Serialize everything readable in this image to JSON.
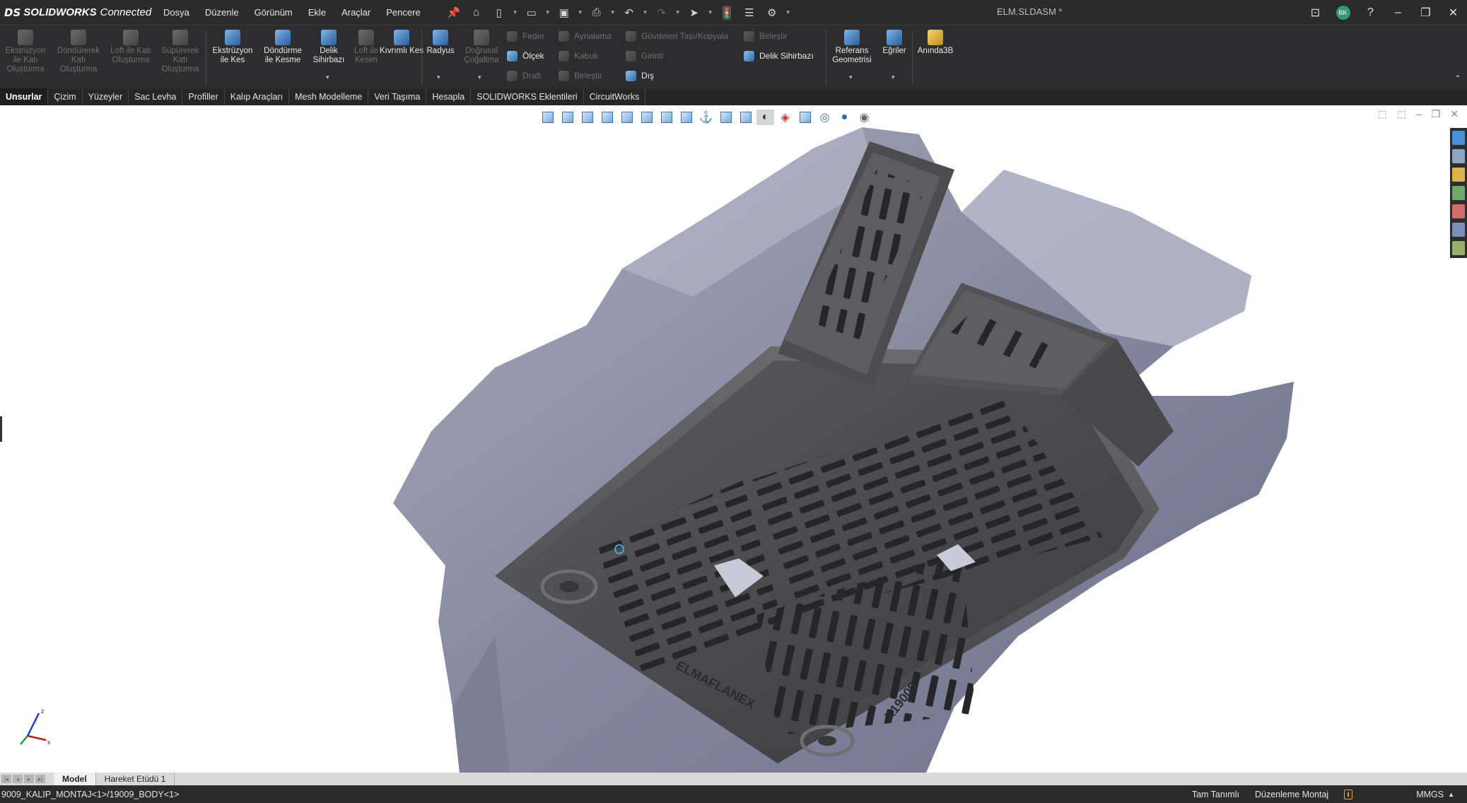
{
  "app": {
    "brand_ds": "DS",
    "brand_name": "SOLIDWORKS",
    "brand_suffix": "Connected",
    "document_title": "ELM.SLDASM *",
    "user_initials": "BK"
  },
  "menu": [
    "Dosya",
    "Düzenle",
    "Görünüm",
    "Ekle",
    "Araçlar",
    "Pencere"
  ],
  "quick_access": [
    "pin-icon",
    "home-icon",
    "new-file-icon",
    "open-file-icon",
    "save-icon",
    "print-icon",
    "undo-icon",
    "redo-icon",
    "select-icon",
    "traffic-light-icon",
    "file-properties-icon",
    "options-gear-icon"
  ],
  "ribbon": {
    "large_buttons": [
      {
        "label": "Ekstrüzyon ile Katı Oluşturma",
        "enabled": false
      },
      {
        "label": "Döndürerek Katı Oluşturma",
        "enabled": false
      },
      {
        "label": "Loft ile Katı Oluşturma",
        "enabled": false
      },
      {
        "label": "Süpürerek Katı Oluşturma",
        "enabled": false
      },
      {
        "label": "Ekstrüzyon ile Kes",
        "enabled": true
      },
      {
        "label": "Döndürme ile Kesme",
        "enabled": true
      },
      {
        "label": "Delik Sihirbazı",
        "enabled": true
      },
      {
        "label": "Loft ile Kesim",
        "enabled": false
      },
      {
        "label": "Kıvrımlı Kes",
        "enabled": true
      },
      {
        "label": "Radyus",
        "enabled": true
      },
      {
        "label": "Doğrusal Çoğaltma",
        "enabled": false
      },
      {
        "label": "Referans Geometrisi",
        "enabled": true
      },
      {
        "label": "Eğriler",
        "enabled": true
      },
      {
        "label": "Anında3B",
        "enabled": true
      }
    ],
    "small_buttons": [
      {
        "label": "Feder",
        "enabled": false
      },
      {
        "label": "Ölçek",
        "enabled": true
      },
      {
        "label": "Draft",
        "enabled": false
      },
      {
        "label": "Aynalama",
        "enabled": false
      },
      {
        "label": "Kabuk",
        "enabled": false
      },
      {
        "label": "Birleştir",
        "enabled": false
      },
      {
        "label": "Gövdeleri Taşı/Kopyala",
        "enabled": false
      },
      {
        "label": "Girinti",
        "enabled": false
      },
      {
        "label": "Dış",
        "enabled": true
      },
      {
        "label": "Birleştir",
        "enabled": false
      },
      {
        "label": "Delik Sihirbazı",
        "enabled": true
      }
    ]
  },
  "tabs": [
    "Unsurlar",
    "Çizim",
    "Yüzeyler",
    "Sac Levha",
    "Profiller",
    "Kalıp Araçları",
    "Mesh Modelleme",
    "Veri Taşıma",
    "Hesapla",
    "SOLIDWORKS Eklentileri",
    "CircuitWorks"
  ],
  "active_tab": "Unsurlar",
  "viewport": {
    "mat_logo_text": "ELMAFLANEX",
    "mat_code_text": "X19009",
    "triad_labels": [
      "z",
      "x",
      "y"
    ]
  },
  "bottom_tabs": [
    "Model",
    "Hareket Etüdü 1"
  ],
  "active_bottom_tab": "Model",
  "status": {
    "path": "9009_KALIP_MONTAJ<1>/19009_BODY<1>",
    "definition": "Tam Tanımlı",
    "mode": "Düzenleme Montaj",
    "units": "MMGS"
  },
  "colors": {
    "titlebar": "#2b2b2b",
    "ribbon": "#2d2d30",
    "scan_mesh": "#8e92a8",
    "mat_surface": "#4a4a4c"
  }
}
